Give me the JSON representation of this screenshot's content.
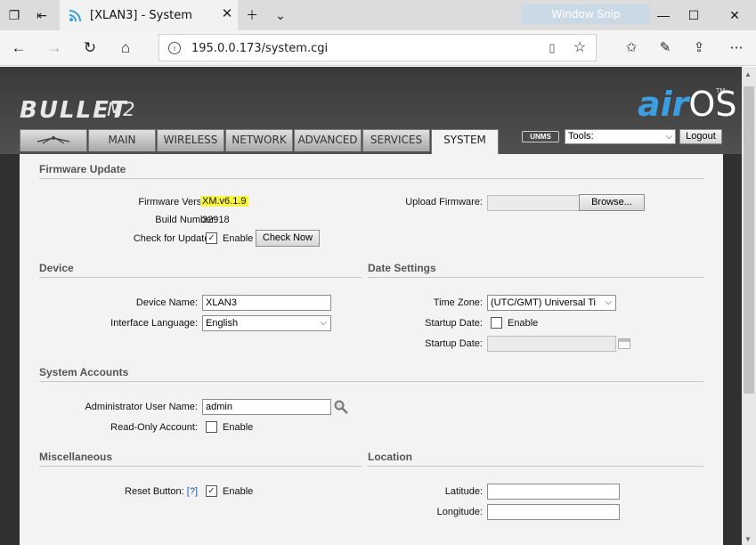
{
  "browser": {
    "tab_title": "[XLAN3] - System",
    "address": "195.0.0.173/system.cgi",
    "window_snip_label": "Window Snip",
    "accent": "#3b9ee0"
  },
  "header": {
    "brand": "BULLET",
    "model": "M2",
    "logo_air": "air",
    "logo_os": "OS",
    "logo_tm": "TM",
    "unms_label": "UNMS",
    "tools_select": "Tools:",
    "logout_label": "Logout",
    "tabs": [
      {
        "label": "MAIN"
      },
      {
        "label": "WIRELESS"
      },
      {
        "label": "NETWORK"
      },
      {
        "label": "ADVANCED"
      },
      {
        "label": "SERVICES"
      },
      {
        "label": "SYSTEM",
        "active": true
      }
    ]
  },
  "firmware": {
    "section": "Firmware Update",
    "version_label": "Firmware Version:",
    "version_value": "XM.v6.1.9",
    "build_label": "Build Number:",
    "build_value": "32918",
    "check_label": "Check for Updates:",
    "check_enable": "Enable",
    "check_now_button": "Check Now",
    "upload_label": "Upload Firmware:",
    "browse_button": "Browse..."
  },
  "device": {
    "section": "Device",
    "name_label": "Device Name:",
    "name_value": "XLAN3",
    "lang_label": "Interface Language:",
    "lang_value": "English"
  },
  "date": {
    "section": "Date Settings",
    "tz_label": "Time Zone:",
    "tz_value": "(UTC/GMT) Universal Ti",
    "startup_label": "Startup Date:",
    "startup_enable": "Enable",
    "startup_date_label": "Startup Date:"
  },
  "accounts": {
    "section": "System Accounts",
    "admin_label": "Administrator User Name:",
    "admin_value": "admin",
    "readonly_label": "Read-Only Account:",
    "readonly_enable": "Enable"
  },
  "misc": {
    "section": "Miscellaneous",
    "reset_label": "Reset Button:",
    "reset_help": "[?]",
    "reset_enable": "Enable"
  },
  "location": {
    "section": "Location",
    "lat_label": "Latitude:",
    "lon_label": "Longitude:"
  }
}
